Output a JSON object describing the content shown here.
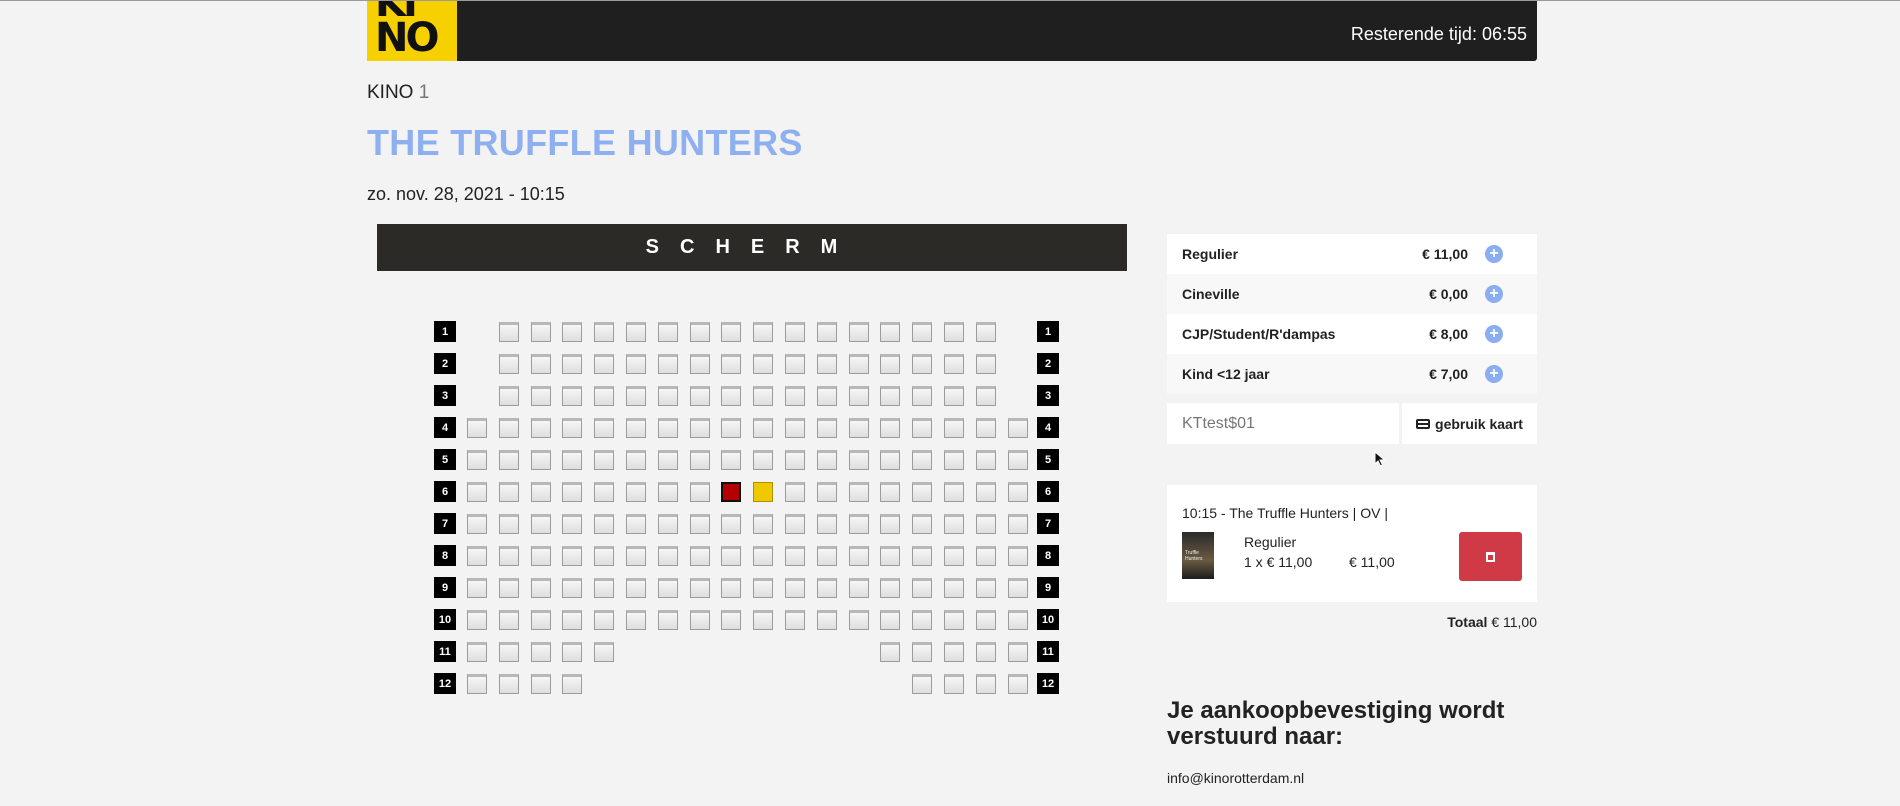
{
  "header": {
    "logo_top": "KI",
    "logo_bottom": "NO",
    "timer_text": "Resterende tijd: 06:55"
  },
  "cinema": {
    "label": "KINO",
    "number": "1"
  },
  "movie": {
    "title": "THE TRUFFLE HUNTERS",
    "datetime": "zo. nov. 28, 2021 - 10:15"
  },
  "screen_label": "SCHERM",
  "seating": {
    "rows": [
      "1",
      "2",
      "3",
      "4",
      "5",
      "6",
      "7",
      "8",
      "9",
      "10",
      "11",
      "12"
    ],
    "row_layout": [
      [
        0,
        0,
        0,
        0,
        0,
        0,
        0,
        0,
        0,
        0,
        0,
        0,
        0,
        0,
        0,
        0
      ],
      [
        0,
        0,
        0,
        0,
        0,
        0,
        0,
        0,
        0,
        0,
        0,
        0,
        0,
        0,
        0,
        0
      ],
      [
        0,
        0,
        0,
        0,
        0,
        0,
        0,
        0,
        0,
        0,
        0,
        0,
        0,
        0,
        0,
        0
      ],
      [
        0,
        0,
        0,
        0,
        0,
        0,
        0,
        0,
        0,
        0,
        0,
        0,
        0,
        0,
        0,
        0,
        0,
        0
      ],
      [
        0,
        0,
        0,
        0,
        0,
        0,
        0,
        0,
        0,
        0,
        0,
        0,
        0,
        0,
        0,
        0,
        0,
        0
      ],
      [
        0,
        0,
        0,
        0,
        0,
        0,
        0,
        0,
        1,
        2,
        0,
        0,
        0,
        0,
        0,
        0,
        0,
        0
      ],
      [
        0,
        0,
        0,
        0,
        0,
        0,
        0,
        0,
        0,
        0,
        0,
        0,
        0,
        0,
        0,
        0,
        0,
        0
      ],
      [
        0,
        0,
        0,
        0,
        0,
        0,
        0,
        0,
        0,
        0,
        0,
        0,
        0,
        0,
        0,
        0,
        0,
        0
      ],
      [
        0,
        0,
        0,
        0,
        0,
        0,
        0,
        0,
        0,
        0,
        0,
        0,
        0,
        0,
        0,
        0,
        0,
        0
      ],
      [
        0,
        0,
        0,
        0,
        0,
        0,
        0,
        0,
        0,
        0,
        0,
        0,
        0,
        0,
        0,
        0,
        0,
        0
      ],
      [
        0,
        0,
        0,
        0,
        0,
        0,
        0,
        0,
        0,
        0
      ],
      [
        0,
        0,
        0,
        0,
        0,
        0,
        0,
        0,
        0
      ]
    ],
    "row_seat_columns": [
      [
        1,
        2,
        3,
        4,
        5,
        6,
        7,
        8,
        9,
        10,
        11,
        12,
        13,
        14,
        15,
        16
      ],
      [
        1,
        2,
        3,
        4,
        5,
        6,
        7,
        8,
        9,
        10,
        11,
        12,
        13,
        14,
        15,
        16
      ],
      [
        1,
        2,
        3,
        4,
        5,
        6,
        7,
        8,
        9,
        10,
        11,
        12,
        13,
        14,
        15,
        16
      ],
      [
        0,
        1,
        2,
        3,
        4,
        5,
        6,
        7,
        8,
        9,
        10,
        11,
        12,
        13,
        14,
        15,
        16,
        17
      ],
      [
        0,
        1,
        2,
        3,
        4,
        5,
        6,
        7,
        8,
        9,
        10,
        11,
        12,
        13,
        14,
        15,
        16,
        17
      ],
      [
        0,
        1,
        2,
        3,
        4,
        5,
        6,
        7,
        8,
        9,
        10,
        11,
        12,
        13,
        14,
        15,
        16,
        17
      ],
      [
        0,
        1,
        2,
        3,
        4,
        5,
        6,
        7,
        8,
        9,
        10,
        11,
        12,
        13,
        14,
        15,
        16,
        17
      ],
      [
        0,
        1,
        2,
        3,
        4,
        5,
        6,
        7,
        8,
        9,
        10,
        11,
        12,
        13,
        14,
        15,
        16,
        17
      ],
      [
        0,
        1,
        2,
        3,
        4,
        5,
        6,
        7,
        8,
        9,
        10,
        11,
        12,
        13,
        14,
        15,
        16,
        17
      ],
      [
        0,
        1,
        2,
        3,
        4,
        5,
        6,
        7,
        8,
        9,
        10,
        11,
        12,
        13,
        14,
        15,
        16,
        17
      ],
      [
        0,
        1,
        2,
        3,
        4,
        13,
        14,
        15,
        16,
        17
      ],
      [
        0,
        1,
        2,
        3,
        14,
        15,
        16,
        17
      ]
    ],
    "seat_state_legend": {
      "0": "available",
      "1": "selected",
      "2": "held"
    },
    "colors": {
      "selected": "#b30000",
      "held": "#f0c800"
    }
  },
  "prices": [
    {
      "name": "Regulier",
      "price": "€ 11,00"
    },
    {
      "name": "Cineville",
      "price": "€ 0,00"
    },
    {
      "name": "CJP/Student/R'dampas",
      "price": "€ 8,00"
    },
    {
      "name": "Kind <12 jaar",
      "price": "€ 7,00"
    }
  ],
  "card": {
    "value": "KTtest$01",
    "button_label": "gebruik kaart"
  },
  "order": {
    "title": "10:15 - The Truffle Hunters | OV |",
    "poster_text": "Truffle Hunters",
    "item_name": "Regulier",
    "item_qty": "1 x € 11,00",
    "item_sum": "€ 11,00"
  },
  "total": {
    "label": "Totaal",
    "value": "€ 11,00"
  },
  "confirm_heading": "Je aankoopbevestiging wordt verstuurd naar:",
  "email": "info@kinorotterdam.nl",
  "accent_color": "#8fb0f0"
}
